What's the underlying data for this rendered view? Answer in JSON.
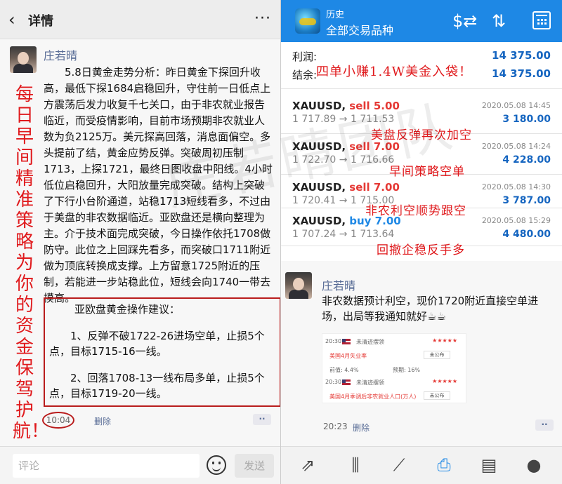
{
  "left_panel": {
    "header": {
      "back_icon": "‹",
      "title": "详情",
      "more_icon": "···"
    },
    "post": {
      "author": "庄若晴",
      "body": "5.8日黄金走势分析：昨日黄金下探回升收高，最低下探1684启稳回升，守住前一日低点上方震荡后发力收复千七关口，由于非农就业报告临近，而受疫情影响，目前市场预期非农就业人数为负2125万。美元探高回落，消息面偏空。多头提前了结，黄金应势反弹。突破周初压制1713，上探1721，最终日图收盘中阳线。4小时低位启稳回升，大阳放量完成突破。结构上突破了下行小台阶通道，站稳1713短线看多，不过由于美盘的非农数据临近。亚欧盘还是横向整理为主。介于技术面完成突破，今日操作依托1708做防守。此位之上回踩先看多，而突破口1711附近做为顶底转换成支撑。上方留意1725附近的压制，若能进一步站稳此位，短线会向1740一带去摸高。",
      "advice_title": "亚欧盘黄金操作建议：",
      "advice_items": [
        "1、反弹不破1722-26进场空单，止损5个点，目标1715-16一线。",
        "2、回落1708-13一线布局多单，止损5个点，目标1719-20一线。"
      ],
      "time": "10:04",
      "delete_label": "删除",
      "more_label": "··"
    },
    "vertical_banner": "每日早间精准策略为你的资金保驾护航！",
    "footer": {
      "comment_placeholder": "评论",
      "send_label": "发送"
    }
  },
  "right_panel": {
    "header": {
      "subtitle": "历史",
      "title": "全部交易品种",
      "icons": [
        "dollar-swap-icon",
        "sort-icon",
        "calendar-icon"
      ]
    },
    "summary": {
      "profit_label": "利润:",
      "profit_value": "14 375.00",
      "balance_label": "结余:",
      "balance_value": "14 375.00",
      "overlay": "四单小赚1.4W美金入袋！"
    },
    "trades": [
      {
        "symbol": "XAUUSD,",
        "side": "sell 5.00",
        "prices": "1 717.89 → 1 711.53",
        "date": "2020.05.08 14:45",
        "profit": "3 180.00",
        "note": "美盘反弹再次加空"
      },
      {
        "symbol": "XAUUSD,",
        "side": "sell 7.00",
        "prices": "1 722.70 → 1 716.66",
        "date": "2020.05.08 14:24",
        "profit": "4 228.00",
        "note": "早间策略空单"
      },
      {
        "symbol": "XAUUSD,",
        "side": "sell 7.00",
        "prices": "1 720.41 → 1 715.00",
        "date": "2020.05.08 14:30",
        "profit": "3 787.00",
        "note": "非农利空顺势跟空"
      },
      {
        "symbol": "XAUUSD,",
        "side": "buy 7.00",
        "prices": "1 707.24 → 1 713.64",
        "date": "2020.05.08 15:29",
        "profit": "4 480.00",
        "note": "回撤企稳反手多"
      }
    ],
    "watermark": "庄若晴团队",
    "second_post": {
      "author": "庄若晴",
      "body": "非农数据预计利空，现价1720附近直接空单进场，出局等我通知就好☕☕",
      "time": "20:23",
      "delete_label": "删除",
      "more_label": "··",
      "card": {
        "rows": [
          {
            "time": "20:30",
            "status": "未清迹摆领",
            "event": "美国4月失业率",
            "pill": "未公布",
            "stars": "★★★★★"
          },
          {
            "time": "20:30",
            "status": "未清迹摆领",
            "event": "美国4月季调后非农就业人口(万人)",
            "pill": "未公布",
            "stars": "★★★★★"
          }
        ],
        "mid_row": {
          "a": "前值: 4.4%",
          "b": "预期: 16%"
        }
      }
    },
    "footer_icons": [
      "new-order-icon",
      "quotes-icon",
      "chart-icon",
      "history-icon",
      "news-icon",
      "chat-icon"
    ]
  }
}
